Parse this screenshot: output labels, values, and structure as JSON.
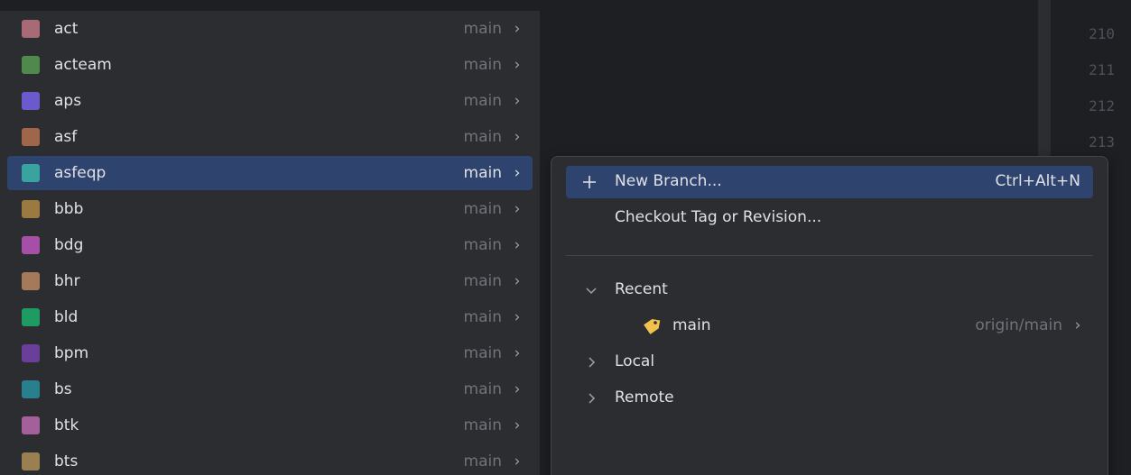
{
  "editor": {
    "line_numbers": [
      "210",
      "211",
      "212",
      "213"
    ]
  },
  "repositories": [
    {
      "name": "act",
      "branch": "main",
      "color": "#a86a74"
    },
    {
      "name": "acteam",
      "branch": "main",
      "color": "#4f8a4c"
    },
    {
      "name": "aps",
      "branch": "main",
      "color": "#6a5acd"
    },
    {
      "name": "asf",
      "branch": "main",
      "color": "#a0664a"
    },
    {
      "name": "asfeqp",
      "branch": "main",
      "color": "#3aa3a0",
      "selected": true
    },
    {
      "name": "bbb",
      "branch": "main",
      "color": "#9a7a40"
    },
    {
      "name": "bdg",
      "branch": "main",
      "color": "#a64fa6"
    },
    {
      "name": "bhr",
      "branch": "main",
      "color": "#a57a5a"
    },
    {
      "name": "bld",
      "branch": "main",
      "color": "#1f9a63"
    },
    {
      "name": "bpm",
      "branch": "main",
      "color": "#6a3f9a"
    },
    {
      "name": "bs",
      "branch": "main",
      "color": "#2a7f8e"
    },
    {
      "name": "btk",
      "branch": "main",
      "color": "#a3609a"
    },
    {
      "name": "bts",
      "branch": "main",
      "color": "#9a8050"
    }
  ],
  "branch_popup": {
    "actions": [
      {
        "label": "New Branch...",
        "shortcut": "Ctrl+Alt+N",
        "icon": "plus-icon",
        "selected": true
      },
      {
        "label": "Checkout Tag or Revision...",
        "shortcut": "",
        "icon": "",
        "selected": false
      }
    ],
    "recent": {
      "label": "Recent",
      "expanded": true,
      "branches": [
        {
          "name": "main",
          "tracking": "origin/main",
          "icon": "tag-icon",
          "icon_color": "#f2c14e"
        }
      ]
    },
    "local": {
      "label": "Local",
      "expanded": false
    },
    "remote": {
      "label": "Remote",
      "expanded": false
    }
  },
  "colors": {
    "selection": "#2e436e",
    "popup_background": "#2b2d30",
    "muted_text": "#6f737a"
  }
}
